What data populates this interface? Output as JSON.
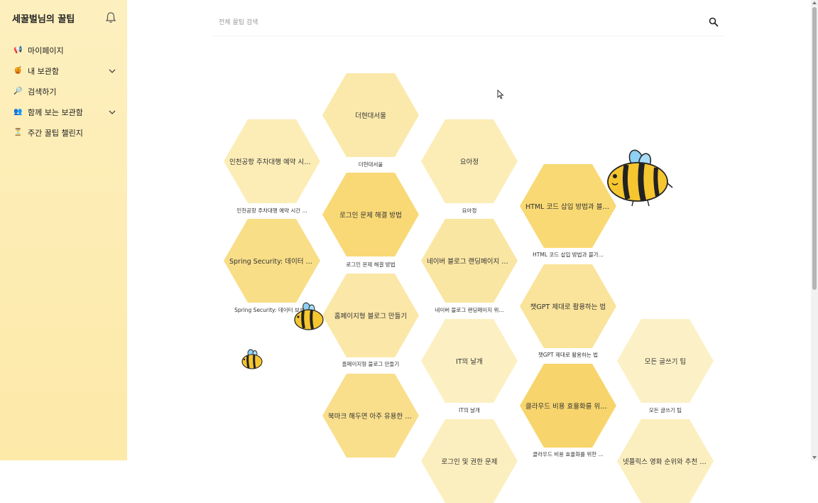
{
  "app": {
    "title": "세꿀벌님의 꿀팁"
  },
  "sidebar": {
    "items": [
      {
        "label": "마이페이지",
        "icon": "megaphone-icon",
        "expandable": false
      },
      {
        "label": "내 보관함",
        "icon": "jar-icon",
        "expandable": true
      },
      {
        "label": "검색하기",
        "icon": "magnifier-icon",
        "expandable": false
      },
      {
        "label": "함께 보는 보관함",
        "icon": "people-icon",
        "expandable": true
      },
      {
        "label": "주간 꿀팁 챌린지",
        "icon": "trophy-icon",
        "expandable": false
      }
    ]
  },
  "search": {
    "placeholder": "전체 꿀팁 검색"
  },
  "tips": [
    {
      "title": "더현대서울",
      "caption": "더현대서울"
    },
    {
      "title": "인천공항 주차대행 예약 시간 ...",
      "caption": "인천공항 주차대행 예약 시간 ..."
    },
    {
      "title": "요아정",
      "caption": "요아정"
    },
    {
      "title": "로그인 문제 해결 방법",
      "caption": "로그인 문제 해결 방법"
    },
    {
      "title": "HTML 코드 삽입 방법과 블가...",
      "caption": "HTML 코드 삽입 방법과 블가..."
    },
    {
      "title": "Spring Security: 데이터 보호...",
      "caption": "Spring Security: 데이터 보호..."
    },
    {
      "title": "네이버 블로그 랜딩페이지 위젯...",
      "caption": "네이버 블로그 랜딩페이지 위..."
    },
    {
      "title": "홈페이지형 블로그 만들기",
      "caption": "홈페이지형 블로그 만들기"
    },
    {
      "title": "챗GPT 제대로 활용하는 법",
      "caption": "챗GPT 제대로 활용하는 법"
    },
    {
      "title": "IT의 날개",
      "caption": "IT의 날개"
    },
    {
      "title": "모든 글쓰기 팁",
      "caption": "모든 글쓰기 팁"
    },
    {
      "title": "클라우드 비용 효율화를 위한 ...",
      "caption": "클라우드 비용 효율화를 위한 ..."
    },
    {
      "title": "북마크 해두면 아주 유용한 꿀...",
      "caption": ""
    },
    {
      "title": "로그인 및 권한 문제",
      "caption": ""
    },
    {
      "title": "넷플릭스 영화 순위와 추천 작품",
      "caption": ""
    }
  ],
  "colors": {
    "sidebar_bg": "#fdeeb9",
    "hex_pale": "#fdf2c6",
    "hex_light": "#fbe7a5",
    "hex_mid": "#f9dd86",
    "hex_strong": "#f7d670",
    "bee_yellow": "#f6c630",
    "bee_wing": "#8fd0f4"
  }
}
